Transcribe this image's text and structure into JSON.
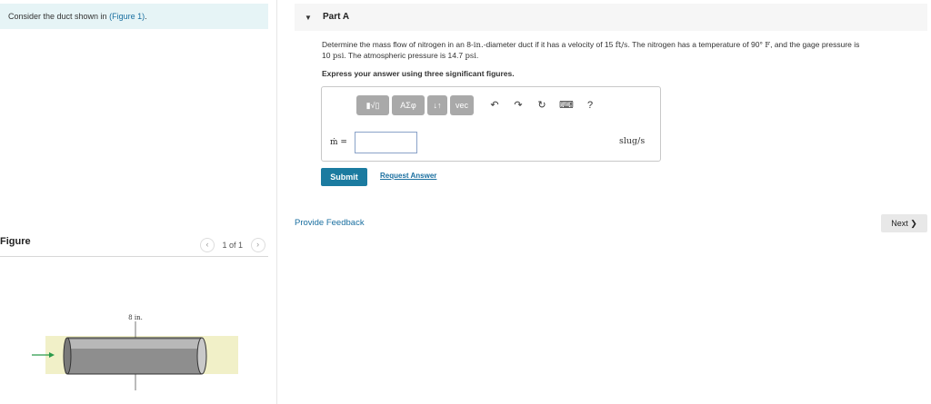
{
  "intro": {
    "prefix": "Consider the duct shown in ",
    "link": "(Figure 1)",
    "suffix": "."
  },
  "figure": {
    "title": "Figure",
    "pager": "1 of 1",
    "prev_icon": "‹",
    "next_icon": "›",
    "dimension_label": "8 in."
  },
  "part": {
    "caret": "▼",
    "title": "Part A",
    "q1": "Determine the mass flow of nitrogen in an 8-",
    "q1_unit": "in.",
    "q2": "-diameter duct if it has a velocity of 15 ",
    "q2_unit": "ft/s",
    "q3": ". The nitrogen has a temperature of 90° ",
    "q3_unit": "F",
    "q4": ", and the gage pressure is",
    "q5": "10 ",
    "q5_unit": "psi",
    "q6": ". The atmospheric pressure is 14.7 ",
    "q6_unit": "psi",
    "q7": ".",
    "instruction": "Express your answer using three significant figures."
  },
  "toolbar": {
    "templates": "▮√▯",
    "greek": "ΑΣφ",
    "arrows": "↓↑",
    "vec": "vec",
    "undo": "↶",
    "redo": "↷",
    "reset": "↻",
    "keyboard": "⌨",
    "help": "?"
  },
  "answer": {
    "label": "ṁ =",
    "value": "",
    "unit": "slug/s"
  },
  "buttons": {
    "submit": "Submit",
    "request": "Request Answer",
    "feedback": "Provide Feedback",
    "next": "Next ❯"
  }
}
